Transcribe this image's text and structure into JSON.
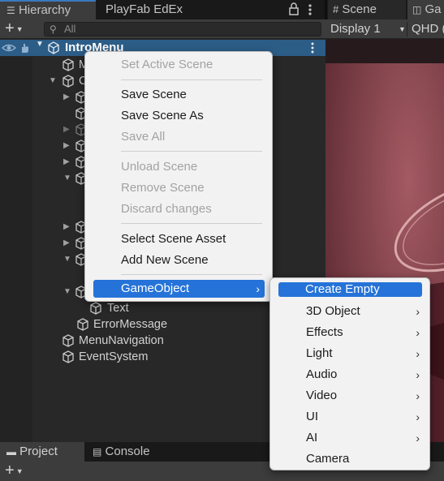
{
  "tabs": {
    "hierarchy": "Hierarchy",
    "playfab": "PlayFab EdEx",
    "scene": "Scene",
    "game": "Ga",
    "project": "Project",
    "console": "Console"
  },
  "hierarchy_toolbar": {
    "add_label": "+",
    "search_placeholder": "All"
  },
  "scene_toolbar": {
    "display": "Display 1",
    "resolution": "QHD ("
  },
  "hierarchy": {
    "scene_name": "IntroMenu",
    "row2_partial": "M",
    "row3_partial": "C",
    "items": [
      {
        "name": "Text"
      },
      {
        "name": "ErrorMessage"
      },
      {
        "name": "MenuNavigation"
      },
      {
        "name": "EventSystem"
      }
    ]
  },
  "context_menu": {
    "items": [
      {
        "label": "Set Active Scene",
        "enabled": false
      },
      {
        "label": "Save Scene",
        "enabled": true
      },
      {
        "label": "Save Scene As",
        "enabled": true
      },
      {
        "label": "Save All",
        "enabled": false
      },
      {
        "label": "Unload Scene",
        "enabled": false
      },
      {
        "label": "Remove Scene",
        "enabled": false
      },
      {
        "label": "Discard changes",
        "enabled": false
      },
      {
        "label": "Select Scene Asset",
        "enabled": true
      },
      {
        "label": "Add New Scene",
        "enabled": true
      },
      {
        "label": "GameObject",
        "enabled": true,
        "submenu": true,
        "highlighted": true
      }
    ]
  },
  "gameobject_submenu": {
    "items": [
      {
        "label": "Create Empty",
        "highlighted": true
      },
      {
        "label": "3D Object",
        "submenu": true
      },
      {
        "label": "Effects",
        "submenu": true
      },
      {
        "label": "Light",
        "submenu": true
      },
      {
        "label": "Audio",
        "submenu": true
      },
      {
        "label": "Video",
        "submenu": true
      },
      {
        "label": "UI",
        "submenu": true
      },
      {
        "label": "AI",
        "submenu": true
      },
      {
        "label": "Camera"
      }
    ]
  },
  "colors": {
    "selection": "#2c5d87",
    "menu_highlight": "#2573d8",
    "game_background": "#7c3d46"
  }
}
